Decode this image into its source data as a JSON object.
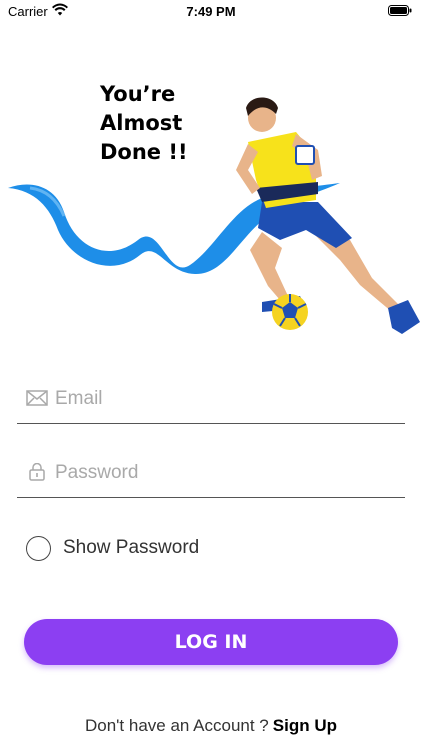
{
  "status_bar": {
    "carrier": "Carrier",
    "time": "7:49 PM"
  },
  "hero": {
    "title_lines": [
      "You’re",
      "Almost",
      "Done !!"
    ],
    "wave_color": "#1e8ee8",
    "shirt_color": "#f7e21b",
    "shorts_color": "#1f4fb3"
  },
  "form": {
    "email": {
      "placeholder": "Email",
      "value": "",
      "icon": "mail-icon"
    },
    "password": {
      "placeholder": "Password",
      "value": "",
      "icon": "lock-icon"
    },
    "show_password": {
      "label": "Show Password",
      "checked": false
    }
  },
  "login_button": {
    "label": "LOG IN",
    "color": "#8c3ff2"
  },
  "footer": {
    "prompt": "Don't have an Account ?",
    "sign_up": "Sign Up"
  }
}
